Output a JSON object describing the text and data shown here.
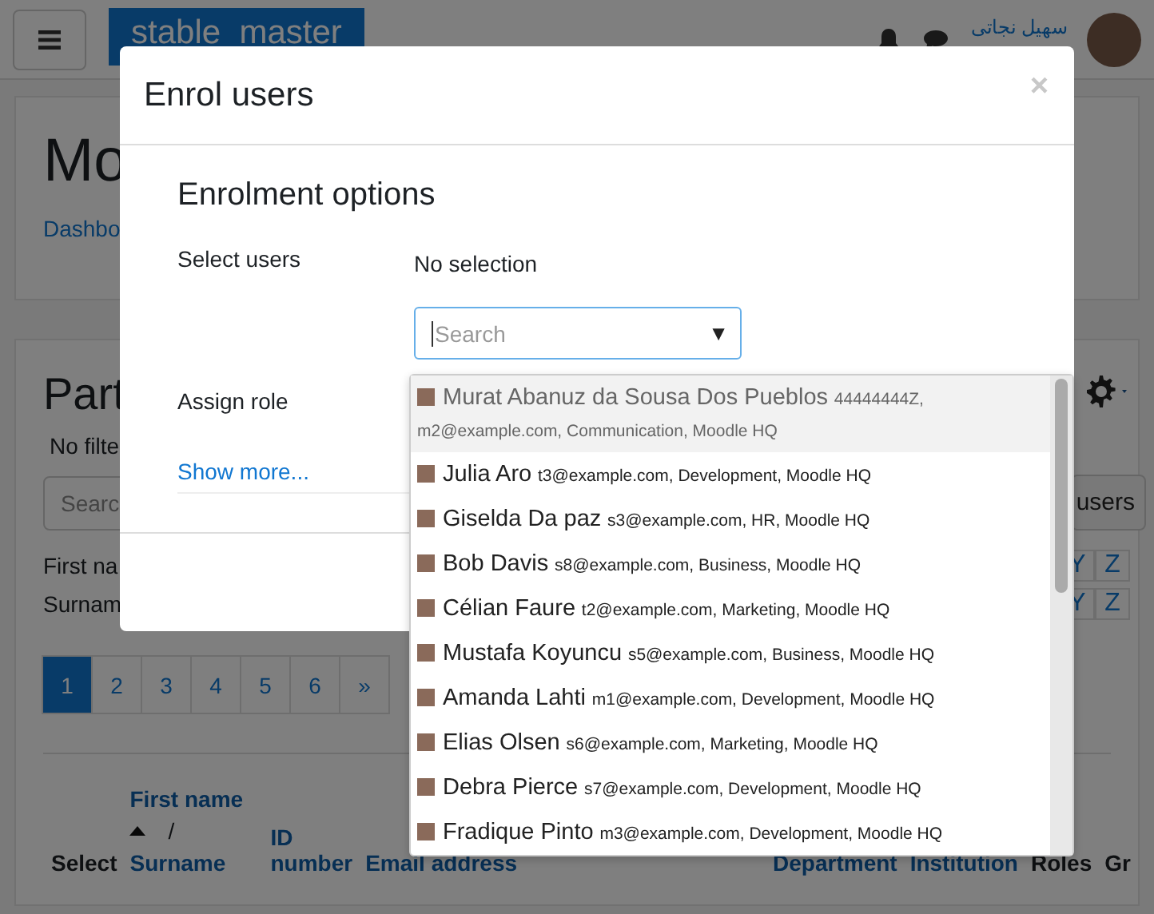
{
  "navbar": {
    "site_name": "stable_master",
    "user_name": "سهیل نجاتی"
  },
  "page_header": {
    "title": "Mo",
    "breadcrumb": "Dashbo"
  },
  "participants": {
    "title": "Part",
    "filter_text": "No filte",
    "search_placeholder": "Searc",
    "enrol_button": "users",
    "initials_rows": [
      {
        "label": "First na",
        "letters": [
          "Y",
          "Z"
        ]
      },
      {
        "label": "Surnam",
        "letters": [
          "Y",
          "Z"
        ]
      }
    ],
    "pagination": [
      {
        "label": "1",
        "selected": true
      },
      {
        "label": "2",
        "selected": false
      },
      {
        "label": "3",
        "selected": false
      },
      {
        "label": "4",
        "selected": false
      },
      {
        "label": "5",
        "selected": false
      },
      {
        "label": "6",
        "selected": false
      },
      {
        "label": "»",
        "selected": false
      }
    ],
    "table_columns": [
      {
        "kind": "plain",
        "label": "Select"
      },
      {
        "kind": "sorted",
        "first": "First name",
        "separator": "/",
        "last": "Surname"
      },
      {
        "kind": "link",
        "label": "ID number"
      },
      {
        "kind": "link",
        "label": "Email address"
      },
      {
        "kind": "link",
        "label": "Department"
      },
      {
        "kind": "link",
        "label": "Institution"
      },
      {
        "kind": "plain",
        "label": "Roles"
      },
      {
        "kind": "plain",
        "label": "Gr"
      }
    ]
  },
  "modal": {
    "title": "Enrol users",
    "close": "×",
    "section_title": "Enrolment options",
    "select_users_label": "Select users",
    "selection_text": "No selection",
    "search_placeholder": "Search",
    "dropdown_arrow": "▼",
    "assign_role_label": "Assign role",
    "show_more": "Show more...",
    "users": [
      {
        "name": "Murat Abanuz da Sousa Dos Pueblos",
        "details": "44444444Z, m2@example.com, Communication, Moodle HQ",
        "selected": true
      },
      {
        "name": "Julia Aro",
        "details": "t3@example.com, Development, Moodle HQ",
        "selected": false
      },
      {
        "name": "Giselda Da paz",
        "details": "s3@example.com, HR, Moodle HQ",
        "selected": false
      },
      {
        "name": "Bob Davis",
        "details": "s8@example.com, Business, Moodle HQ",
        "selected": false
      },
      {
        "name": "Célian Faure",
        "details": "t2@example.com, Marketing, Moodle HQ",
        "selected": false
      },
      {
        "name": "Mustafa Koyuncu",
        "details": "s5@example.com, Business, Moodle HQ",
        "selected": false
      },
      {
        "name": "Amanda Lahti",
        "details": "m1@example.com, Development, Moodle HQ",
        "selected": false
      },
      {
        "name": "Elias Olsen",
        "details": "s6@example.com, Marketing, Moodle HQ",
        "selected": false
      },
      {
        "name": "Debra Pierce",
        "details": "s7@example.com, Development, Moodle HQ",
        "selected": false
      },
      {
        "name": "Fradique Pinto",
        "details": "m3@example.com, Development, Moodle HQ",
        "selected": false
      }
    ]
  }
}
